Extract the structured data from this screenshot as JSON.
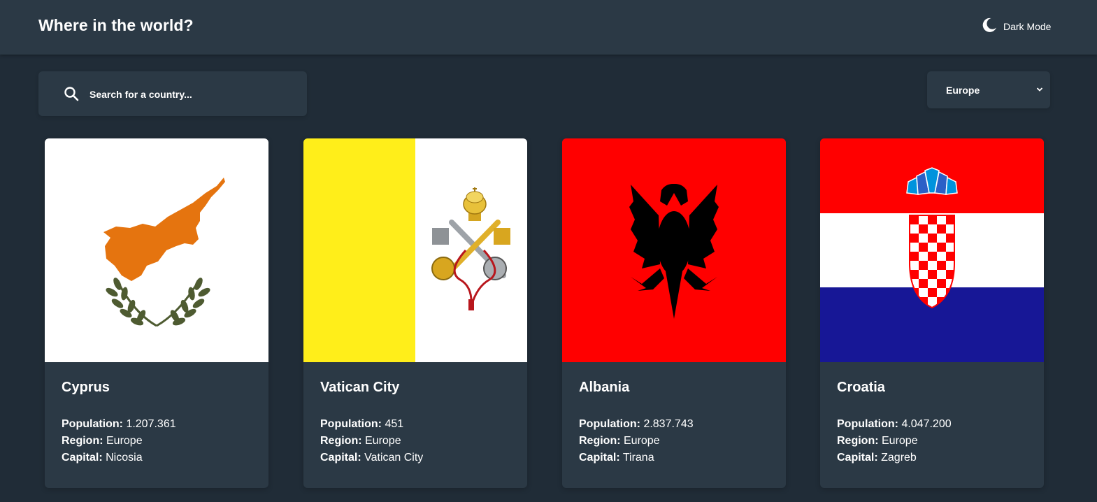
{
  "header": {
    "title": "Where in the world?",
    "mode_label": "Dark Mode",
    "mode_icon": "moon-icon"
  },
  "search": {
    "placeholder": "Search for a country...",
    "icon": "search-icon"
  },
  "filter": {
    "selected": "Europe",
    "icon": "chevron-down-icon"
  },
  "labels": {
    "population": "Population:",
    "region": "Region:",
    "capital": "Capital:"
  },
  "countries": [
    {
      "name": "Cyprus",
      "population": "1.207.361",
      "region": "Europe",
      "capital": "Nicosia",
      "flag": "cyprus-flag"
    },
    {
      "name": "Vatican City",
      "population": "451",
      "region": "Europe",
      "capital": "Vatican City",
      "flag": "vatican-flag"
    },
    {
      "name": "Albania",
      "population": "2.837.743",
      "region": "Europe",
      "capital": "Tirana",
      "flag": "albania-flag"
    },
    {
      "name": "Croatia",
      "population": "4.047.200",
      "region": "Europe",
      "capital": "Zagreb",
      "flag": "croatia-flag"
    }
  ],
  "colors": {
    "background": "#202c37",
    "element": "#2b3945",
    "text": "#ffffff"
  }
}
